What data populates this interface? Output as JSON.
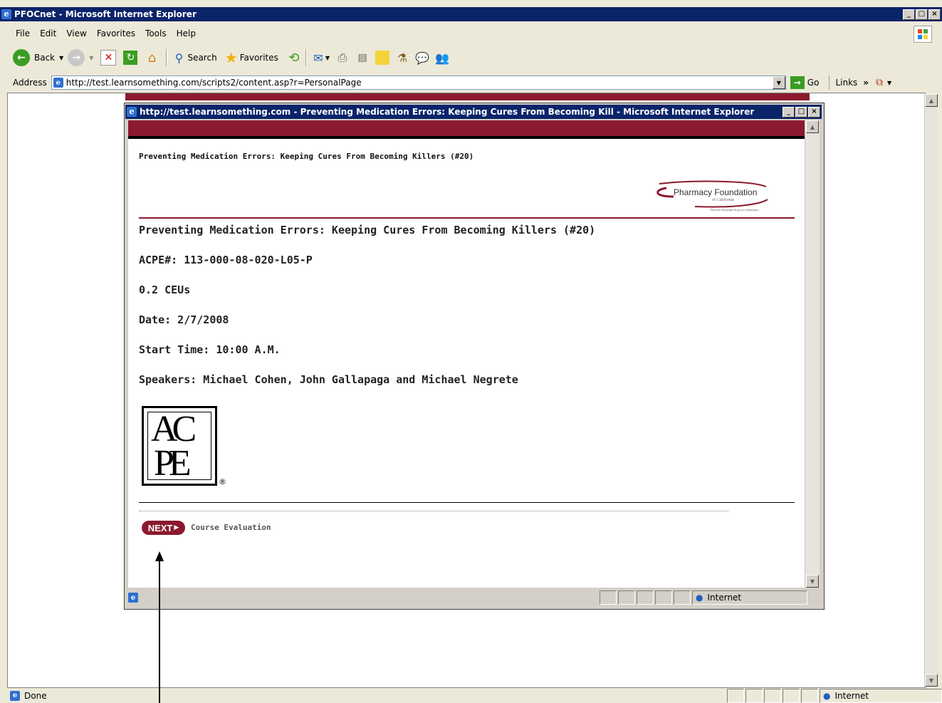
{
  "main_window": {
    "title": "PFOCnet - Microsoft Internet Explorer",
    "menu": [
      {
        "label": "File"
      },
      {
        "label": "Edit"
      },
      {
        "label": "View"
      },
      {
        "label": "Favorites"
      },
      {
        "label": "Tools"
      },
      {
        "label": "Help"
      }
    ],
    "toolbar": {
      "back_label": "Back",
      "search_label": "Search",
      "favorites_label": "Favorites"
    },
    "address": {
      "label": "Address",
      "url": "http://test.learnsomething.com/scripts2/content.asp?r=PersonalPage",
      "go_label": "Go",
      "links_label": "Links",
      "chevron": "»"
    },
    "status": {
      "text": "Done",
      "zone": "Internet"
    }
  },
  "popup_window": {
    "title": "http://test.learnsomething.com - Preventing Medication Errors: Keeping Cures From Becoming Kill - Microsoft Internet Explorer",
    "header_title": "Preventing Medication Errors: Keeping Cures From Becoming Killers (#20)",
    "logo": {
      "name": "Pharmacy Foundation",
      "sub": "of California",
      "tagline": "Discover the people & power of pharmacy"
    },
    "course": {
      "title": "Preventing Medication Errors: Keeping Cures From Becoming Killers (#20)",
      "acpe": "ACPE#: 113-000-08-020-L05-P",
      "ceus": "0.2 CEUs",
      "date": "Date: 2/7/2008",
      "start_time": "Start Time: 10:00 A.M.",
      "speakers": "Speakers: Michael Cohen, John Gallapaga and Michael Negrete"
    },
    "acpe_logo": {
      "letters_top": "AC",
      "letters_bottom": "PE",
      "registered": "®"
    },
    "next_button": "NEXT",
    "next_link": "Course Evaluation",
    "status": {
      "zone": "Internet"
    }
  },
  "colors": {
    "titlebar": "#0a246a",
    "brand_maroon": "#8b1a2e",
    "chrome": "#ece9d8"
  }
}
